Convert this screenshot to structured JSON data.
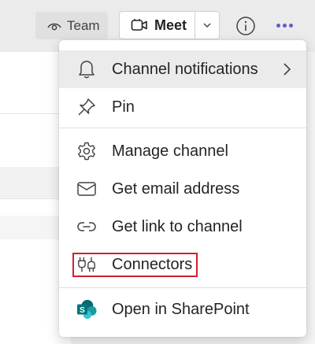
{
  "header": {
    "team_label": "Team",
    "meet_label": "Meet"
  },
  "menu": {
    "items": [
      {
        "label": "Channel notifications"
      },
      {
        "label": "Pin"
      },
      {
        "label": "Manage channel"
      },
      {
        "label": "Get email address"
      },
      {
        "label": "Get link to channel"
      },
      {
        "label": "Connectors"
      },
      {
        "label": "Open in SharePoint"
      }
    ]
  },
  "colors": {
    "accent": "#5b5fc7",
    "highlight_border": "#d0202c",
    "sharepoint": "#038387"
  }
}
